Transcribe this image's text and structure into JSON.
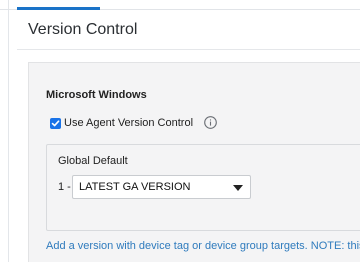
{
  "header": {
    "title": "Version Control"
  },
  "section": {
    "title": "Microsoft Windows",
    "checkbox": {
      "label": "Use Agent Version Control",
      "checked": true
    },
    "info_icon": "info-circle-icon"
  },
  "default_group": {
    "label": "Global Default",
    "priority": "1 -",
    "selected_version": "LATEST GA VERSION"
  },
  "footnote": "Add a version with device tag or device group targets. NOTE: this",
  "colors": {
    "accent": "#1a73c8",
    "link": "#2f7bbd",
    "panel_bg": "#f4f4f5"
  }
}
